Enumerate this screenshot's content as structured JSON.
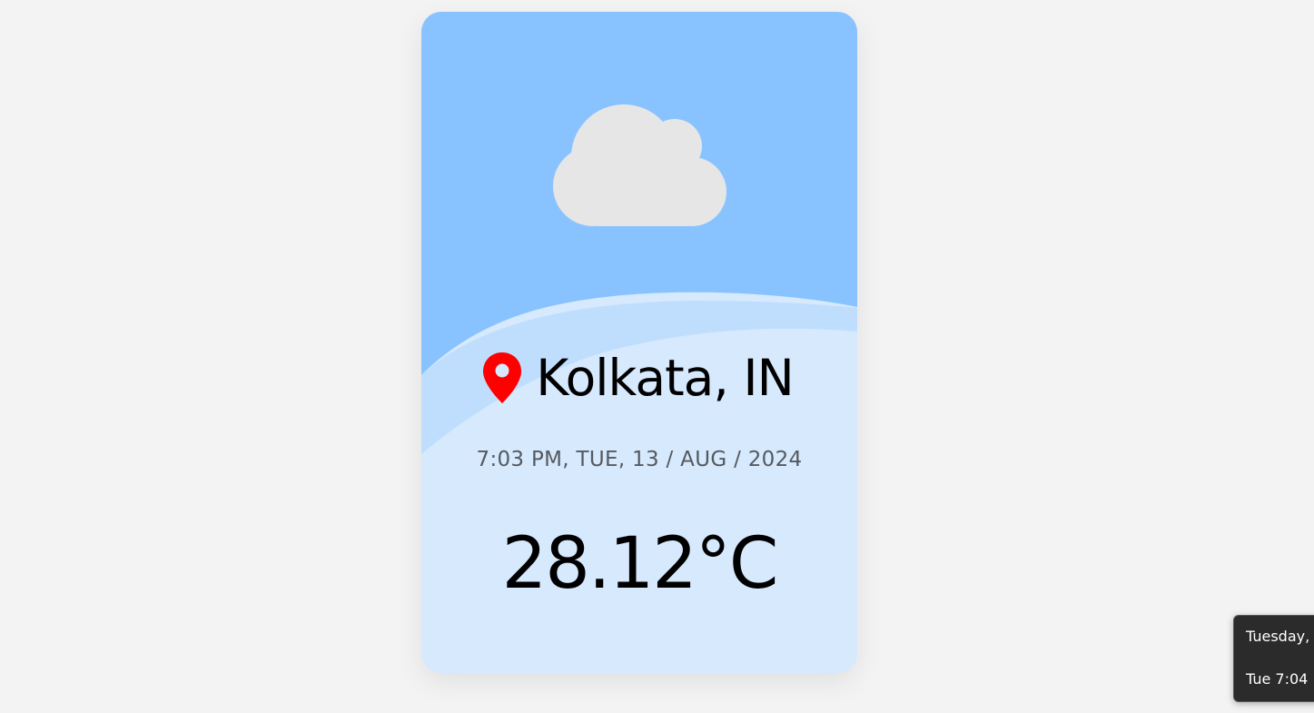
{
  "weather_card": {
    "condition_icon": "cloud-icon",
    "location_icon": "map-pin-icon",
    "location": "Kolkata, IN",
    "datetime": "7:03 PM, TUE, 13 / AUG / 2024",
    "temperature": "28.12°C",
    "colors": {
      "sky": "#89c3ff",
      "card_bottom": "#d6e9fd",
      "cloud": "#e6e6e6",
      "pin": "#ff0000"
    }
  },
  "taskbar_tooltip": {
    "line1": "Tuesday,",
    "line2": "Tue 7:04"
  }
}
